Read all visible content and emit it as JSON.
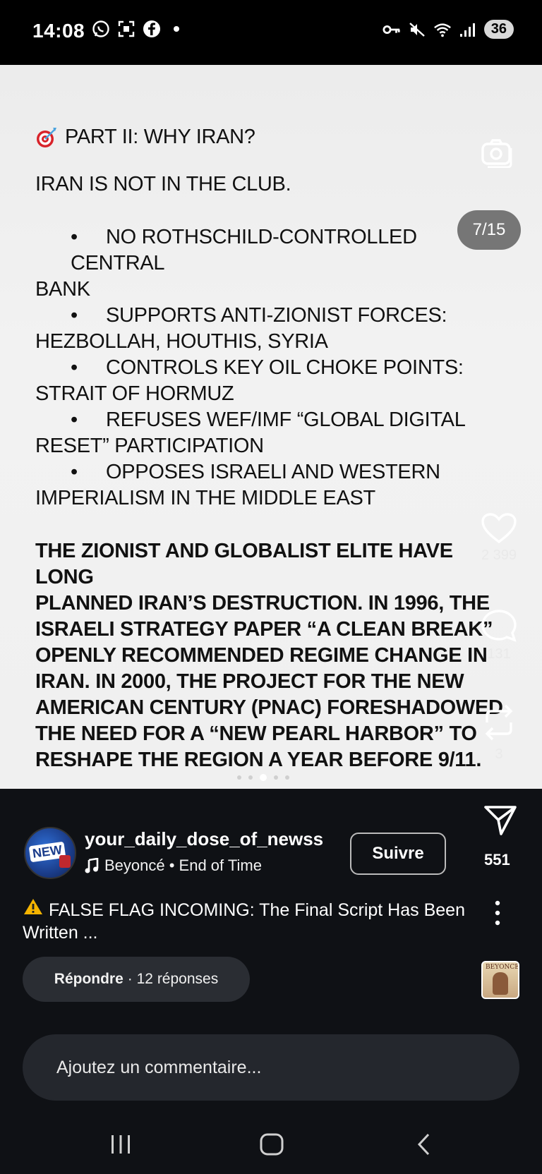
{
  "status_bar": {
    "time": "14:08",
    "battery": "36",
    "left_icons": [
      "whatsapp-icon",
      "screenshot-icon",
      "facebook-icon",
      "notification-dot"
    ],
    "right_icons": [
      "key-icon",
      "mute-icon",
      "wifi-icon",
      "signal-icon",
      "battery-icon"
    ]
  },
  "post": {
    "counter": "7/15",
    "heading": "PART II: WHY IRAN?",
    "subheading": "IRAN IS NOT IN THE CLUB.",
    "bullet_char": "•",
    "bullets": [
      {
        "first": "NO ROTHSCHILD-CONTROLLED CENTRAL",
        "rest": "BANK"
      },
      {
        "first": "SUPPORTS ANTI-ZIONIST FORCES:",
        "rest": "HEZBOLLAH, HOUTHIS, SYRIA"
      },
      {
        "first": "CONTROLS KEY OIL CHOKE POINTS:",
        "rest": "STRAIT OF HORMUZ"
      },
      {
        "first": "REFUSES WEF/IMF “GLOBAL DIGITAL",
        "rest": "RESET” PARTICIPATION"
      },
      {
        "first": "OPPOSES ISRAELI AND WESTERN",
        "rest": "IMPERIALISM IN THE MIDDLE EAST"
      }
    ],
    "body_lines": [
      "THE ZIONIST AND GLOBALIST ELITE HAVE LONG",
      "PLANNED IRAN’S DESTRUCTION. IN 1996, THE",
      "ISRAELI STRATEGY PAPER “A CLEAN BREAK”",
      "OPENLY RECOMMENDED REGIME CHANGE IN",
      "IRAN. IN 2000, THE PROJECT FOR THE NEW",
      "AMERICAN CENTURY (PNAC) FORESHADOWED",
      "THE NEED FOR A “NEW PEARL HARBOR” TO",
      "RESHAPE THE REGION A YEAR BEFORE 9/11."
    ],
    "carousel_dots": 5,
    "carousel_active_index": 2
  },
  "actions": {
    "likes": "2 399",
    "comments": "131",
    "reposts": "3",
    "shares": "551"
  },
  "author": {
    "username": "your_daily_dose_of_newss",
    "avatar_badge": "NEW",
    "music": "Beyoncé • End of Time",
    "follow_label": "Suivre"
  },
  "caption": {
    "text": "FALSE FLAG INCOMING: The Final Script Has Been Written ..."
  },
  "replies": {
    "reply_label": "Répondre",
    "count_text": "· 12 réponses"
  },
  "music_thumb": {
    "label": "BEYONCÉ"
  },
  "comment_input": {
    "placeholder": "Ajoutez un commentaire..."
  },
  "nav": {
    "buttons": [
      "recents-icon",
      "home-icon",
      "back-icon"
    ]
  }
}
